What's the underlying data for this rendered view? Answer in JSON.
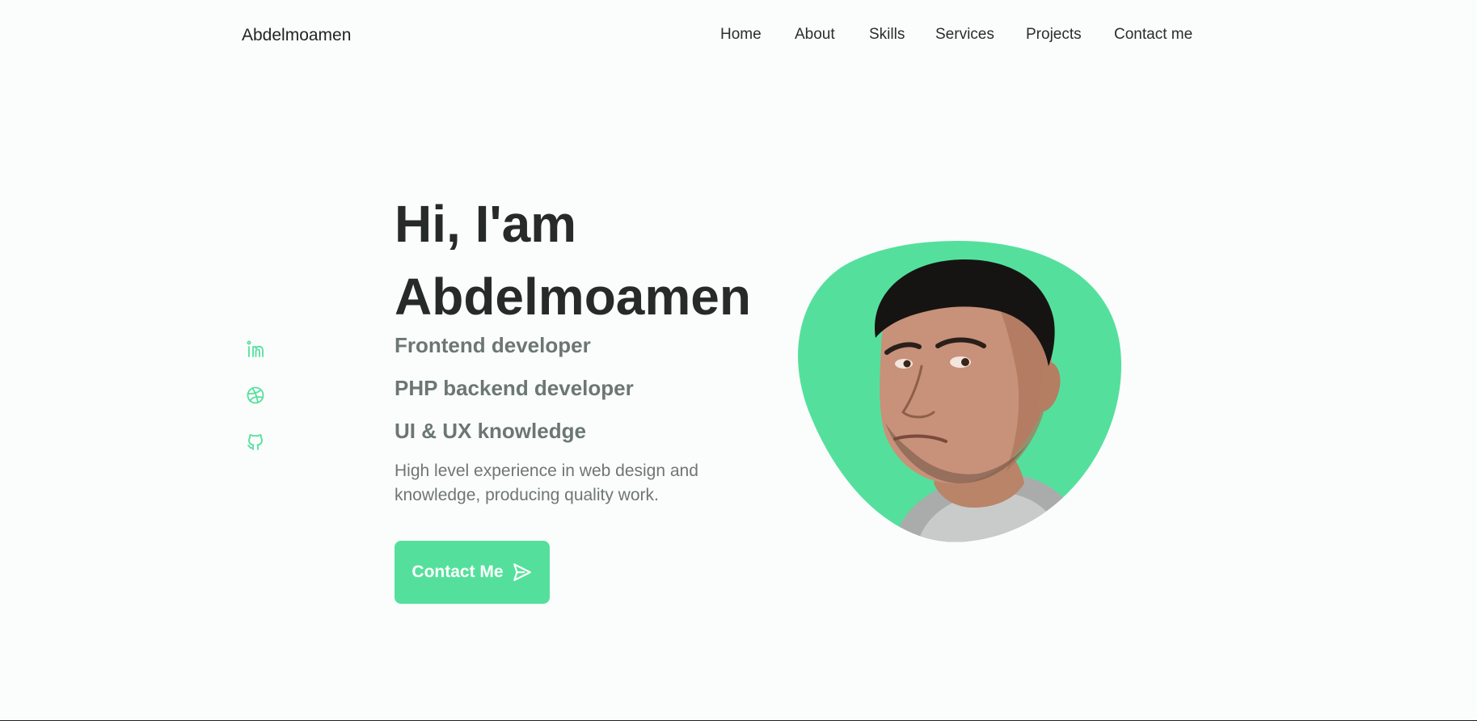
{
  "brand": {
    "name": "Abdelmoamen"
  },
  "nav": {
    "items": [
      {
        "label": "Home"
      },
      {
        "label": "About"
      },
      {
        "label": "Skills"
      },
      {
        "label": "Services"
      },
      {
        "label": "Projects"
      },
      {
        "label": "Contact me"
      }
    ]
  },
  "social": {
    "icons": [
      "linkedin-icon",
      "dribbble-icon",
      "github-icon"
    ]
  },
  "hero": {
    "greeting": "Hi, I'am",
    "name": "Abdelmoamen",
    "roles": [
      "Frontend developer",
      "PHP backend developer",
      "UI & UX knowledge"
    ],
    "description": "High level experience in web design and knowledge, producing quality work.",
    "button_label": "Contact Me",
    "button_icon": "send-icon"
  },
  "colors": {
    "accent": "#54e09c",
    "text_dark": "#262a29",
    "text_muted": "#6c7772",
    "background": "#fbfdfd"
  }
}
